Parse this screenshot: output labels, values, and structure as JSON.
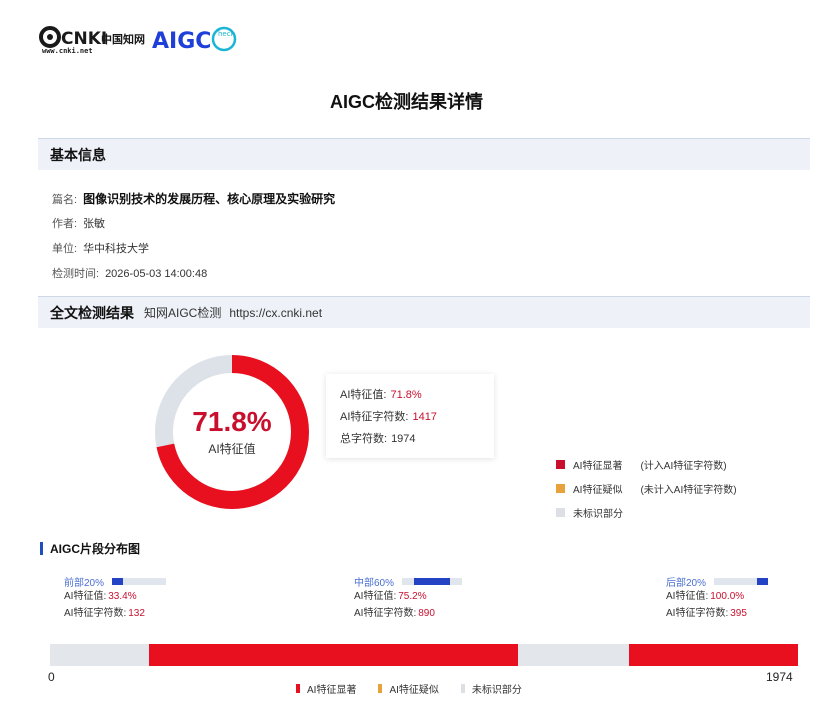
{
  "header": {
    "logo_text": "CNKI",
    "logo_cn": "中国知网",
    "logo_url": "www.cnki.net",
    "aigc_logo": "AIGC",
    "aigc_sub": "heck"
  },
  "title": "AIGC检测结果详情",
  "basic_info": {
    "heading": "基本信息",
    "fields": [
      {
        "key": "篇名:",
        "value": "图像识别技术的发展历程、核心原理及实验研究"
      },
      {
        "key": "作者:",
        "value": "张敏"
      },
      {
        "key": "单位:",
        "value": "华中科技大学"
      },
      {
        "key": "检测时间:",
        "value": "2026-05-03 14:00:48"
      }
    ]
  },
  "full_result": {
    "heading": "全文检测结果",
    "subtitle": "知网AIGC检测",
    "url": "https://cx.cnki.net"
  },
  "donut": {
    "percent_text": "71.8%",
    "percent_value": 71.8,
    "label": "AI特征值"
  },
  "stats": {
    "ai_value_label": "AI特征值:",
    "ai_value": "71.8%",
    "ai_chars_label": "AI特征字符数:",
    "ai_chars": "1417",
    "total_label": "总字符数:",
    "total": "1974"
  },
  "legend": [
    {
      "color": "#c8102e",
      "label": "AI特征显著",
      "note": "(计入AI特征字符数)"
    },
    {
      "color": "#e8a23c",
      "label": "AI特征疑似",
      "note": "(未计入AI特征字符数)"
    },
    {
      "color": "#dcdfe4",
      "label": "未标识部分",
      "note": ""
    }
  ],
  "distribution": {
    "title": "AIGC片段分布图",
    "segments": [
      {
        "name": "前部20%",
        "ai_label": "AI特征值:",
        "ai_value": "33.4%",
        "chars_label": "AI特征字符数:",
        "chars": "132",
        "indicator_start": 0.0,
        "indicator_end": 0.2
      },
      {
        "name": "中部60%",
        "ai_label": "AI特征值:",
        "ai_value": "75.2%",
        "chars_label": "AI特征字符数:",
        "chars": "890",
        "indicator_start": 0.2,
        "indicator_end": 0.8
      },
      {
        "name": "后部20%",
        "ai_label": "AI特征值:",
        "ai_value": "100.0%",
        "chars_label": "AI特征字符数:",
        "chars": "395",
        "indicator_start": 0.8,
        "indicator_end": 1.0
      }
    ],
    "bar": {
      "start": 0,
      "end": 1974,
      "start_label": "0",
      "end_label": "1974",
      "red_ranges": [
        [
          261,
          1236
        ],
        [
          1529,
          1974
        ]
      ]
    },
    "legend": [
      {
        "color": "#e8101e",
        "label": "AI特征显著"
      },
      {
        "color": "#e8a23c",
        "label": "AI特征疑似"
      },
      {
        "color": "#dcdfe4",
        "label": "未标识部分"
      }
    ]
  }
}
